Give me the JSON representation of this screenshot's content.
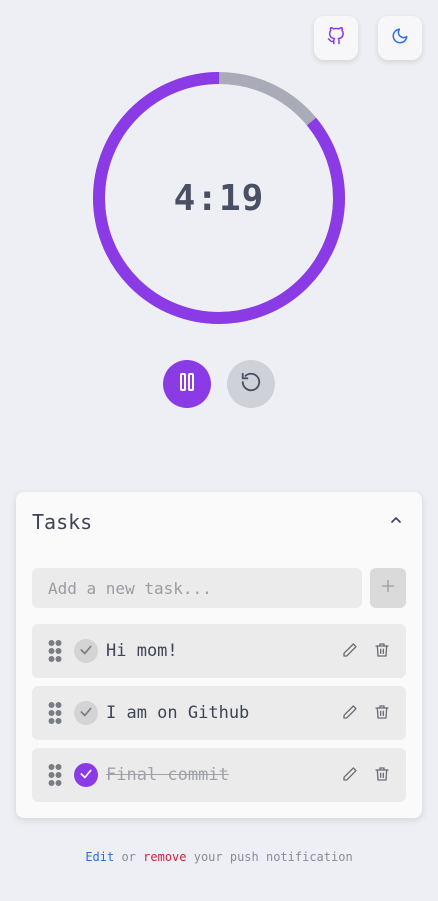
{
  "header": {
    "github_icon": "github-icon",
    "theme_icon": "moon-icon"
  },
  "timer": {
    "time": "4:19",
    "progress": 0.86,
    "colors": {
      "progress": "#8b3be6",
      "track": "#a9acb8"
    }
  },
  "controls": {
    "pause_icon": "pause-icon",
    "reset_icon": "reset-icon"
  },
  "tasks": {
    "title": "Tasks",
    "input_placeholder": "Add a new task...",
    "input_value": "",
    "items": [
      {
        "text": "Hi mom!",
        "done": false
      },
      {
        "text": "I am on Github",
        "done": false
      },
      {
        "text": "Final commit",
        "done": true
      }
    ]
  },
  "footer": {
    "edit": "Edit",
    "or": "or",
    "remove": "remove",
    "rest": "your push notification"
  },
  "colors": {
    "accent": "#8b3be6",
    "background": "#eeeff5"
  }
}
